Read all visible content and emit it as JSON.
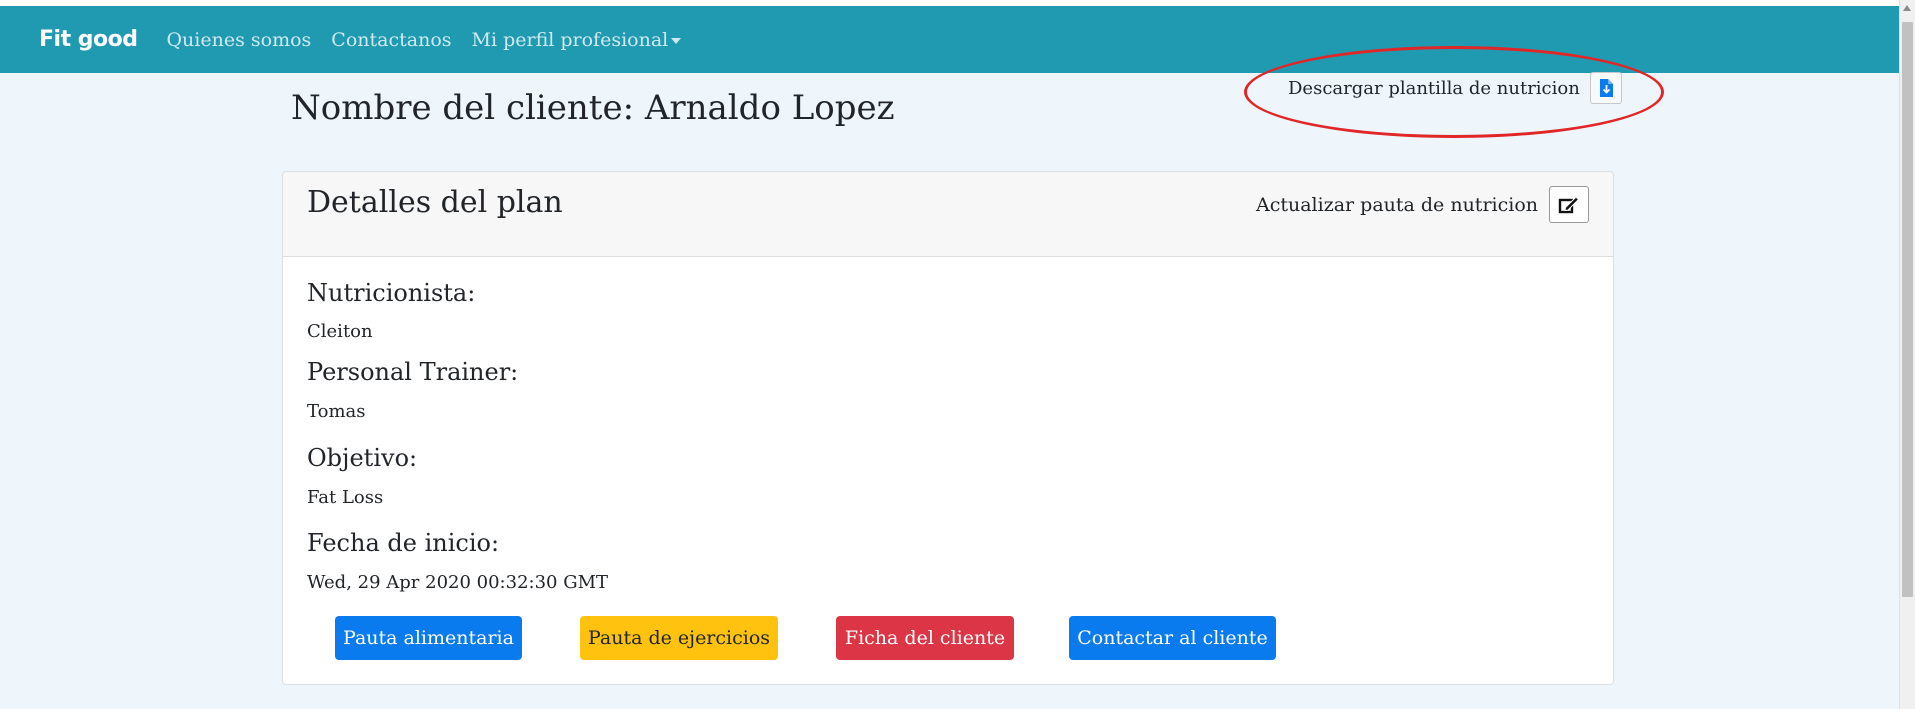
{
  "navbar": {
    "brand": "Fit good",
    "links": [
      "Quienes somos",
      "Contactanos",
      "Mi perfil profesional"
    ]
  },
  "page": {
    "client_title": "Nombre del cliente: Arnaldo Lopez",
    "download_label": "Descargar plantilla de nutricion"
  },
  "card": {
    "title": "Detalles del plan",
    "update_label": "Actualizar pauta de nutricion",
    "fields": [
      {
        "label": "Nutricionista:",
        "value": "Cleiton"
      },
      {
        "label": "Personal Trainer:",
        "value": "Tomas"
      },
      {
        "label": "Objetivo:",
        "value": "Fat Loss"
      },
      {
        "label": "Fecha de inicio:",
        "value": "Wed, 29 Apr 2020 00:32:30 GMT"
      }
    ],
    "buttons": [
      {
        "label": "Pauta alimentaria",
        "style": "primary"
      },
      {
        "label": "Pauta de ejercicios",
        "style": "warning"
      },
      {
        "label": "Ficha del cliente",
        "style": "danger"
      },
      {
        "label": "Contactar al cliente",
        "style": "primary"
      }
    ]
  },
  "icons": {
    "download": "file-download-icon",
    "edit": "edit-icon",
    "caret": "chevron-down-icon"
  },
  "colors": {
    "navbar": "#1f9ab1",
    "page_background": "#eef6fc",
    "primary": "#0a7bef",
    "warning": "#ffc20e",
    "danger": "#dc3545",
    "annotation": "#e02626"
  }
}
